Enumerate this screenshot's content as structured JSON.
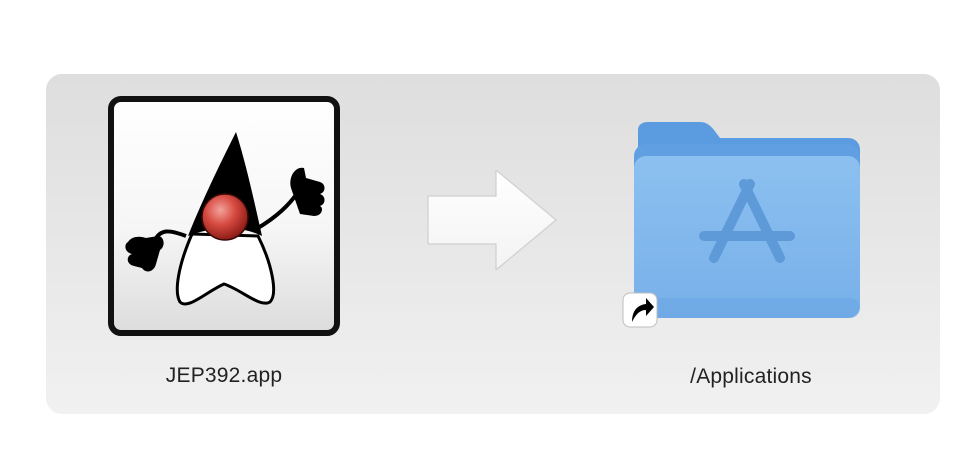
{
  "app": {
    "label": "JEP392.app",
    "icon": "java-duke-icon"
  },
  "arrow": {
    "icon": "right-arrow-icon"
  },
  "applications": {
    "label": "/Applications",
    "icon": "applications-folder-icon",
    "alias_icon": "alias-arrow-icon"
  },
  "colors": {
    "panel": "#e6e6e6",
    "folder": "#7fb7ec",
    "duke_nose": "#c9302c"
  }
}
